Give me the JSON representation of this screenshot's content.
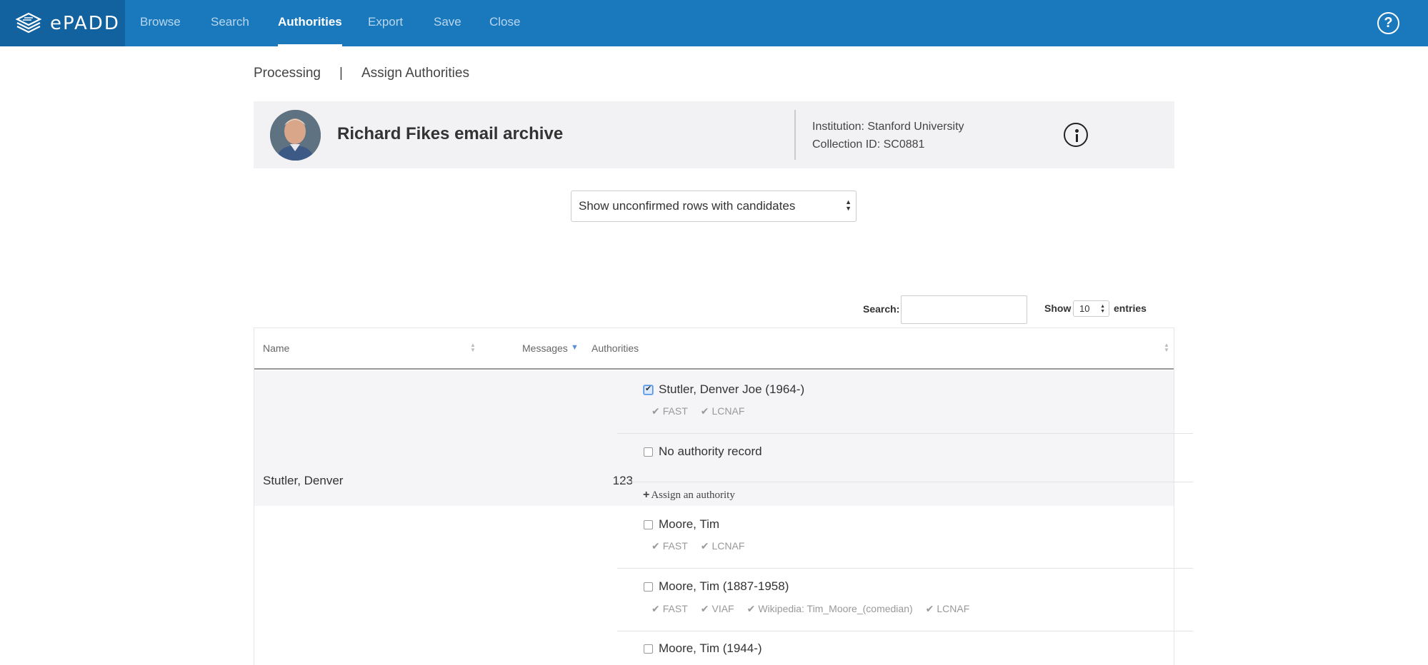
{
  "nav": {
    "logo": "ePADD",
    "items": [
      "Browse",
      "Search",
      "Authorities",
      "Export",
      "Save",
      "Close"
    ],
    "active": "Authorities",
    "help": "?"
  },
  "breadcrumb": {
    "parent": "Processing",
    "separator": "|",
    "current": "Assign Authorities"
  },
  "archive": {
    "title": "Richard Fikes email archive",
    "institution": "Institution: Stanford University",
    "collection": "Collection ID: SC0881"
  },
  "filter": {
    "selected": "Show unconfirmed rows with candidates"
  },
  "table_controls": {
    "search_label": "Search:",
    "search_value": "",
    "show_label": "Show",
    "entries_value": "10",
    "entries_label": "entries"
  },
  "table": {
    "headers": {
      "name": "Name",
      "messages": "Messages",
      "authorities": "Authorities"
    },
    "rows": [
      {
        "name": "Stutler, Denver",
        "messages": "123",
        "candidates": [
          {
            "label": "Stutler, Denver Joe (1964-)",
            "checked": true,
            "sources": [
              "FAST",
              "LCNAF"
            ]
          },
          {
            "label": "No authority record",
            "checked": false,
            "sources": []
          }
        ],
        "assign": "Assign an authority"
      },
      {
        "name": "",
        "messages": "",
        "candidates": [
          {
            "label": "Moore, Tim",
            "checked": false,
            "sources": [
              "FAST",
              "LCNAF"
            ]
          },
          {
            "label": "Moore, Tim (1887-1958)",
            "checked": false,
            "sources": [
              "FAST",
              "VIAF",
              "Wikipedia: Tim_Moore_(comedian)",
              "LCNAF"
            ]
          },
          {
            "label": "Moore, Tim (1944-)",
            "checked": false,
            "sources": []
          }
        ]
      }
    ]
  },
  "colors": {
    "nav_bg": "#1a78bd",
    "logo_bg": "#11629f",
    "card_bg": "#f2f2f4"
  }
}
